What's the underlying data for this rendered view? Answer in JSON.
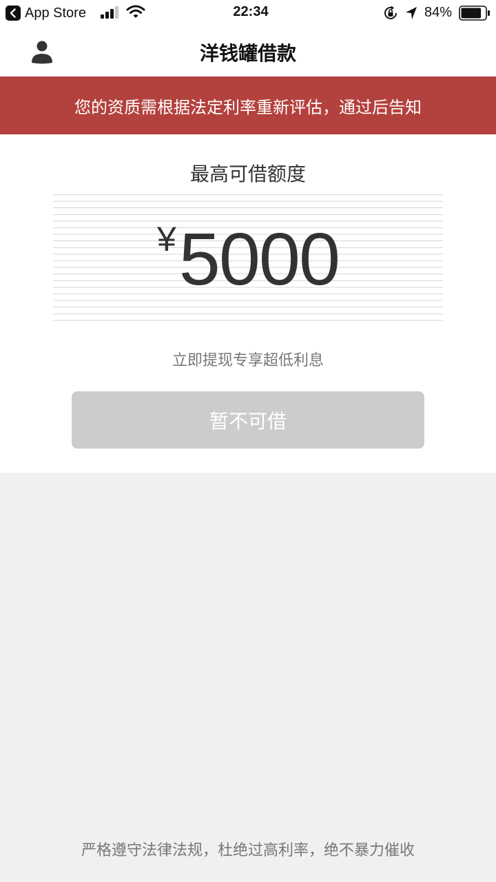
{
  "status_bar": {
    "back_app_label": "App Store",
    "time": "22:34",
    "battery_percent": "84%",
    "battery_level": 0.84,
    "back_icon": "chevron-left-icon",
    "signal_icon": "cellular-signal-icon",
    "wifi_icon": "wifi-icon",
    "rotation_lock_icon": "rotation-lock-icon",
    "location_icon": "location-arrow-icon",
    "battery_icon": "battery-icon"
  },
  "nav": {
    "title": "洋钱罐借款",
    "user_icon": "user-icon"
  },
  "notice": {
    "text": "您的资质需根据法定利率重新评估，通过后告知",
    "background": "#b3413d"
  },
  "loan": {
    "limit_title": "最高可借额度",
    "currency_symbol": "¥",
    "amount": "5000",
    "subtitle": "立即提现专享超低利息",
    "button_label": "暂不可借",
    "button_color": "#cccccc"
  },
  "footer": {
    "text": "严格遵守法律法规，杜绝过高利率，绝不暴力催收"
  }
}
